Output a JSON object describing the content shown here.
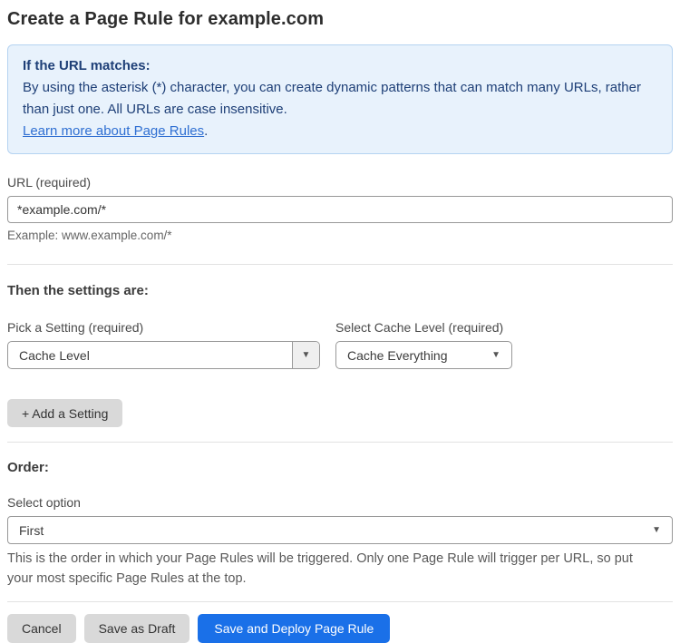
{
  "page": {
    "title": "Create a Page Rule for example.com"
  },
  "info_box": {
    "heading": "If the URL matches:",
    "body": "By using the asterisk (*) character, you can create dynamic patterns that can match many URLs, rather than just one. All URLs are case insensitive.",
    "link_label": "Learn more about Page Rules",
    "link_suffix": "."
  },
  "url_field": {
    "label": "URL (required)",
    "value": "*example.com/*",
    "hint": "Example: www.example.com/*"
  },
  "settings_section": {
    "heading": "Then the settings are:",
    "setting_picker": {
      "label": "Pick a Setting (required)",
      "value": "Cache Level"
    },
    "cache_level_picker": {
      "label": "Select Cache Level (required)",
      "value": "Cache Everything"
    },
    "add_setting_label": "+ Add a Setting"
  },
  "order_section": {
    "heading": "Order:",
    "select_label": "Select option",
    "value": "First",
    "help": "This is the order in which your Page Rules will be triggered. Only one Page Rule will trigger per URL, so put your most specific Page Rules at the top."
  },
  "actions": {
    "cancel": "Cancel",
    "save_draft": "Save as Draft",
    "save_deploy": "Save and Deploy Page Rule"
  },
  "icons": {
    "dropdown_caret": "▼"
  },
  "colors": {
    "accent_blue": "#1a70e8",
    "info_background": "#e8f2fc",
    "info_border": "#b5d3f1",
    "info_text": "#1e3f77",
    "link_blue": "#2f6fd2",
    "button_gray": "#d9d9d9"
  }
}
